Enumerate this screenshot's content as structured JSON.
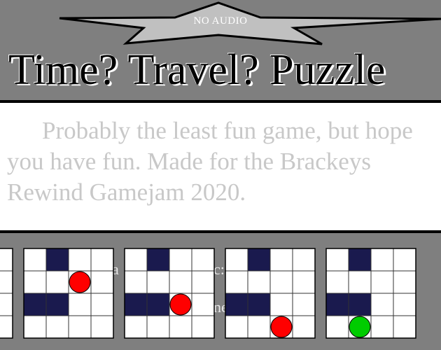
{
  "audio": {
    "label": "NO AUDIO"
  },
  "title": "Time? Travel? Puzzle",
  "description": "Probably the least fun game, but hope you have fun. Made for the Brackeys Rewind Gamejam 2020.",
  "ghost_text": {
    "line1": "a",
    "line2": "c:",
    "line3": "ne"
  },
  "colors": {
    "background": "#7f7f7f",
    "panel": "#ffffff",
    "star": "#c0c0c0",
    "wall": "#1a1a4e",
    "cell": "#ffffff",
    "grid_line": "#333333",
    "token_red": "#ff0000",
    "token_green": "#00cc00"
  },
  "boards": [
    {
      "walls": [
        [
          0,
          1
        ],
        [
          2,
          0
        ],
        [
          2,
          1
        ]
      ],
      "token": null
    },
    {
      "walls": [
        [
          0,
          1
        ],
        [
          2,
          0
        ],
        [
          2,
          1
        ]
      ],
      "token": {
        "row": 1,
        "col": 2,
        "color": "red"
      }
    },
    {
      "walls": [
        [
          0,
          1
        ],
        [
          2,
          0
        ],
        [
          2,
          1
        ]
      ],
      "token": {
        "row": 2,
        "col": 2,
        "color": "red"
      }
    },
    {
      "walls": [
        [
          0,
          1
        ],
        [
          2,
          0
        ],
        [
          2,
          1
        ]
      ],
      "token": {
        "row": 3,
        "col": 2,
        "color": "red"
      }
    },
    {
      "walls": [
        [
          0,
          1
        ],
        [
          2,
          0
        ],
        [
          2,
          1
        ]
      ],
      "token": {
        "row": 3,
        "col": 1,
        "color": "green"
      }
    }
  ]
}
